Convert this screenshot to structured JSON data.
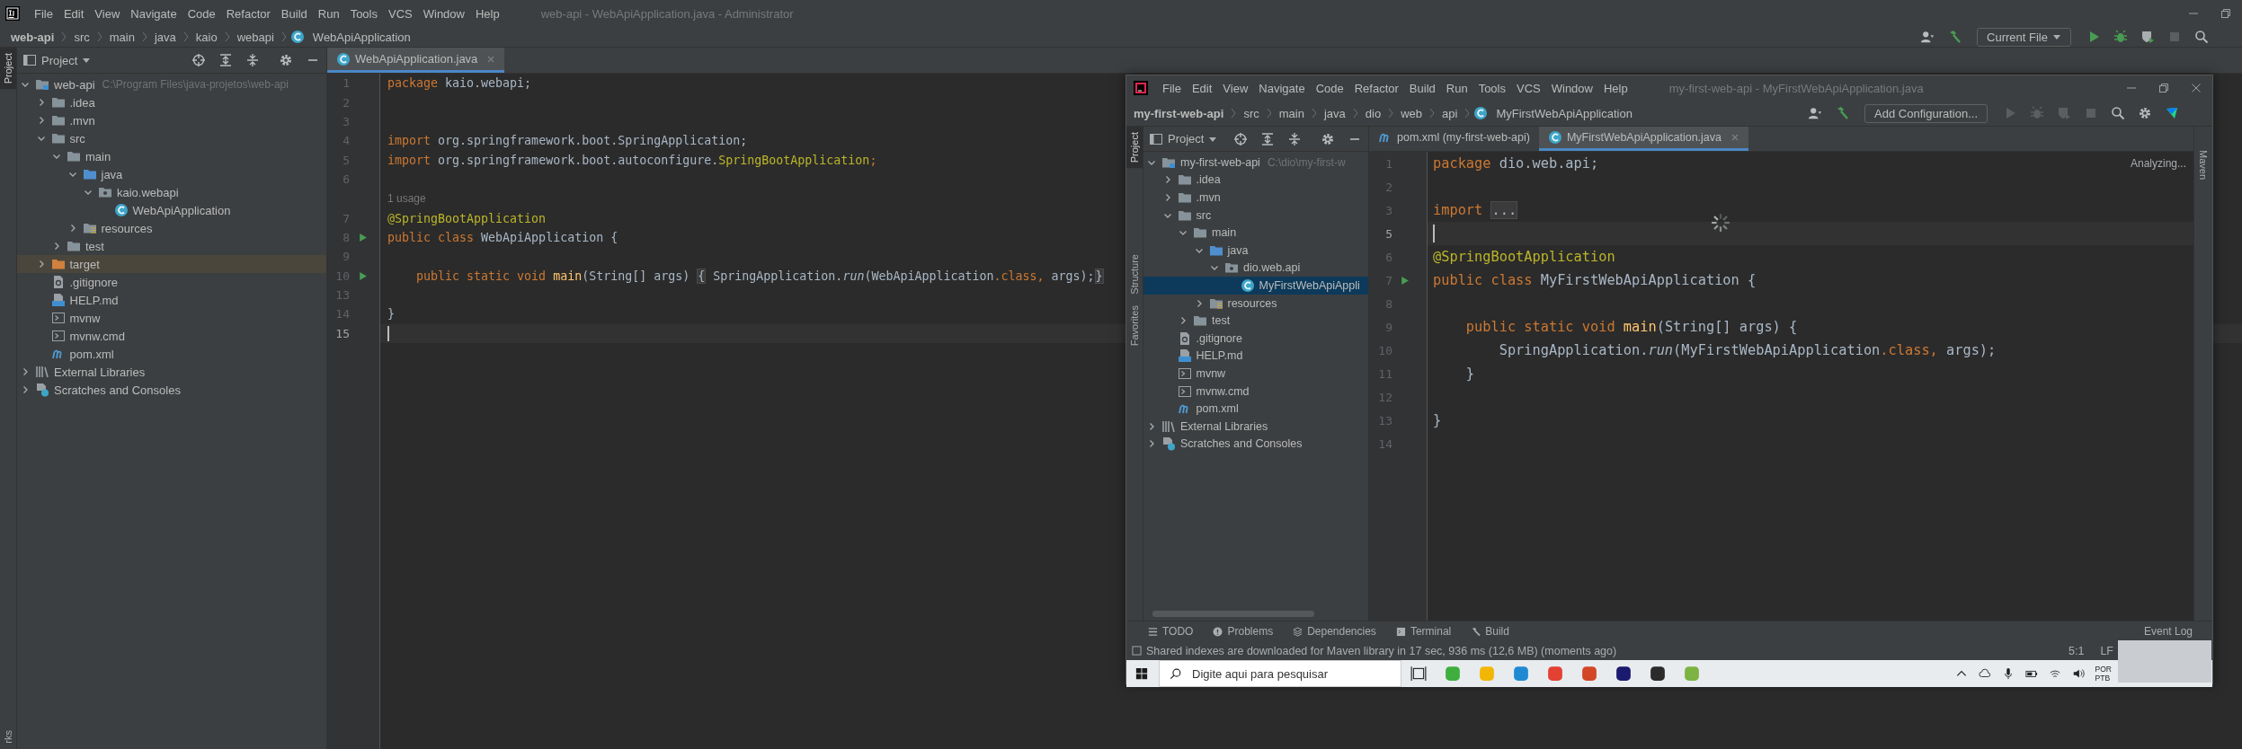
{
  "outer": {
    "menu": [
      "File",
      "Edit",
      "View",
      "Navigate",
      "Code",
      "Refactor",
      "Build",
      "Run",
      "Tools",
      "VCS",
      "Window",
      "Help"
    ],
    "title": "web-api - WebApiApplication.java - Administrator",
    "breadcrumb": [
      "web-api",
      "src",
      "main",
      "java",
      "kaio",
      "webapi",
      "WebApiApplication"
    ],
    "run_config": "Current File",
    "side_tabs": [
      {
        "label": "Project",
        "selected": true
      }
    ],
    "bottom_side_tab": "rks",
    "project": {
      "title": "Project",
      "tree": [
        {
          "label": "web-api",
          "path": "C:\\Program Files\\java-projetos\\web-api",
          "kind": "module",
          "expanded": true,
          "selected": false,
          "children": [
            {
              "label": ".idea",
              "kind": "folder",
              "expanded": false,
              "selected": false
            },
            {
              "label": ".mvn",
              "kind": "folder",
              "expanded": false,
              "selected": false
            },
            {
              "label": "src",
              "kind": "folder",
              "expanded": true,
              "selected": false,
              "children": [
                {
                  "label": "main",
                  "kind": "folder",
                  "expanded": true,
                  "selected": false,
                  "children": [
                    {
                      "label": "java",
                      "kind": "source",
                      "expanded": true,
                      "selected": false,
                      "children": [
                        {
                          "label": "kaio.webapi",
                          "kind": "package",
                          "expanded": true,
                          "selected": false,
                          "children": [
                            {
                              "label": "WebApiApplication",
                              "kind": "class",
                              "selected": false
                            }
                          ]
                        }
                      ]
                    },
                    {
                      "label": "resources",
                      "kind": "resources",
                      "expanded": false,
                      "selected": false
                    }
                  ]
                },
                {
                  "label": "test",
                  "kind": "folder",
                  "expanded": false,
                  "selected": false
                }
              ]
            },
            {
              "label": "target",
              "kind": "excluded",
              "expanded": false,
              "selected": false
            },
            {
              "label": ".gitignore",
              "kind": "ignore",
              "selected": false
            },
            {
              "label": "HELP.md",
              "kind": "markdown",
              "selected": false
            },
            {
              "label": "mvnw",
              "kind": "script",
              "selected": false
            },
            {
              "label": "mvnw.cmd",
              "kind": "script",
              "selected": false
            },
            {
              "label": "pom.xml",
              "kind": "maven",
              "selected": false
            }
          ]
        },
        {
          "label": "External Libraries",
          "kind": "libraries",
          "expanded": false,
          "selected": false
        },
        {
          "label": "Scratches and Consoles",
          "kind": "scratches",
          "expanded": false,
          "selected": false
        }
      ]
    },
    "tabs": [
      {
        "label": "WebApiApplication.java",
        "selected": true
      }
    ],
    "code": [
      {
        "kind": "code",
        "number": "1",
        "current": false,
        "run": false,
        "tokens": [
          {
            "kind": "kw",
            "text": "package"
          },
          {
            "kind": "plain",
            "text": " kaio.webapi;"
          }
        ]
      },
      {
        "kind": "code",
        "number": "2",
        "current": false,
        "run": false
      },
      {
        "kind": "code",
        "number": "3",
        "current": false,
        "run": false
      },
      {
        "kind": "code",
        "number": "4",
        "current": false,
        "run": false,
        "tokens": [
          {
            "kind": "kw",
            "text": "import"
          },
          {
            "kind": "plain",
            "text": " org.springframework.boot.SpringApplication;"
          }
        ]
      },
      {
        "kind": "code",
        "number": "5",
        "current": false,
        "run": false,
        "tokens": [
          {
            "kind": "kw",
            "text": "import"
          },
          {
            "kind": "plain",
            "text": " org.springframework.boot.autoconfigure."
          },
          {
            "kind": "ann",
            "text": "SpringBootApplication"
          },
          {
            "kind": "kw",
            "text": ";"
          }
        ]
      },
      {
        "kind": "code",
        "number": "6",
        "current": false,
        "run": false
      },
      {
        "kind": "hint",
        "text": "1 usage"
      },
      {
        "kind": "code",
        "number": "7",
        "current": false,
        "run": false,
        "tokens": [
          {
            "kind": "ann",
            "text": "@SpringBootApplication"
          }
        ]
      },
      {
        "kind": "code",
        "number": "8",
        "current": false,
        "run": true,
        "tokens": [
          {
            "kind": "kw",
            "text": "public class "
          },
          {
            "kind": "plain",
            "text": "WebApiApplication {"
          }
        ]
      },
      {
        "kind": "code",
        "number": "9",
        "current": false,
        "run": false
      },
      {
        "kind": "code",
        "number": "10",
        "current": false,
        "run": true,
        "tokens": [
          {
            "kind": "kw",
            "text": "    public static void "
          },
          {
            "kind": "fn",
            "text": "main"
          },
          {
            "kind": "plain",
            "text": "(String[] args) "
          },
          {
            "kind": "fold",
            "text": "{"
          },
          {
            "kind": "plain",
            "text": " SpringApplication."
          },
          {
            "kind": "static",
            "text": "run"
          },
          {
            "kind": "plain",
            "text": "(WebApiApplication"
          },
          {
            "kind": "kw",
            "text": ".class, "
          },
          {
            "kind": "plain",
            "text": "args);"
          },
          {
            "kind": "fold",
            "text": "}"
          }
        ]
      },
      {
        "kind": "code",
        "number": "13",
        "current": false,
        "run": false
      },
      {
        "kind": "code",
        "number": "14",
        "current": false,
        "run": false,
        "tokens": [
          {
            "kind": "plain",
            "text": "}"
          }
        ]
      },
      {
        "kind": "code",
        "number": "15",
        "current": true,
        "run": false
      }
    ]
  },
  "inner": {
    "menu": [
      "File",
      "Edit",
      "View",
      "Navigate",
      "Code",
      "Refactor",
      "Build",
      "Run",
      "Tools",
      "VCS",
      "Window",
      "Help"
    ],
    "title": "my-first-web-api - MyFirstWebApiApplication.java",
    "breadcrumb": [
      "my-first-web-api",
      "src",
      "main",
      "java",
      "dio",
      "web",
      "api",
      "MyFirstWebApiApplication"
    ],
    "run_config": "Add Configuration...",
    "side_tabs": [
      {
        "label": "Project",
        "selected": true
      },
      {
        "label": "Structure",
        "selected": false
      },
      {
        "label": "Favorites",
        "selected": false
      }
    ],
    "right_tabs": [
      "Maven"
    ],
    "project": {
      "title": "Project",
      "tree": [
        {
          "label": "my-first-web-api",
          "path": "C:\\dio\\my-first-w",
          "kind": "module",
          "expanded": true,
          "selected": false,
          "children": [
            {
              "label": ".idea",
              "kind": "folder",
              "expanded": false,
              "selected": false
            },
            {
              "label": ".mvn",
              "kind": "folder",
              "expanded": false,
              "selected": false
            },
            {
              "label": "src",
              "kind": "folder",
              "expanded": true,
              "selected": false,
              "children": [
                {
                  "label": "main",
                  "kind": "folder",
                  "expanded": true,
                  "selected": false,
                  "children": [
                    {
                      "label": "java",
                      "kind": "source",
                      "expanded": true,
                      "selected": false,
                      "children": [
                        {
                          "label": "dio.web.api",
                          "kind": "package",
                          "expanded": true,
                          "selected": false,
                          "children": [
                            {
                              "label": "MyFirstWebApiAppli",
                              "kind": "class",
                              "selected": true
                            }
                          ]
                        }
                      ]
                    },
                    {
                      "label": "resources",
                      "kind": "resources",
                      "expanded": false,
                      "selected": false
                    }
                  ]
                },
                {
                  "label": "test",
                  "kind": "folder",
                  "expanded": false,
                  "selected": false
                }
              ]
            },
            {
              "label": ".gitignore",
              "kind": "ignore",
              "selected": false
            },
            {
              "label": "HELP.md",
              "kind": "markdown",
              "selected": false
            },
            {
              "label": "mvnw",
              "kind": "script",
              "selected": false
            },
            {
              "label": "mvnw.cmd",
              "kind": "script",
              "selected": false
            },
            {
              "label": "pom.xml",
              "kind": "maven",
              "selected": false
            }
          ]
        },
        {
          "label": "External Libraries",
          "kind": "libraries",
          "expanded": false,
          "selected": false
        },
        {
          "label": "Scratches and Consoles",
          "kind": "scratches",
          "expanded": false,
          "selected": false
        }
      ]
    },
    "tabs": [
      {
        "label": "pom.xml (my-first-web-api)",
        "kind": "maven",
        "selected": false
      },
      {
        "label": "MyFirstWebApiApplication.java",
        "kind": "class",
        "selected": true
      }
    ],
    "analyzing": "Analyzing...",
    "code": [
      {
        "kind": "code",
        "number": "1",
        "current": false,
        "run": false,
        "tokens": [
          {
            "kind": "kw",
            "text": "package"
          },
          {
            "kind": "plain",
            "text": " dio.web.api;"
          }
        ]
      },
      {
        "kind": "code",
        "number": "2",
        "current": false,
        "run": false
      },
      {
        "kind": "code",
        "number": "3",
        "current": false,
        "run": false,
        "tokens": [
          {
            "kind": "kw",
            "text": "import "
          },
          {
            "kind": "fold",
            "text": "..."
          }
        ]
      },
      {
        "kind": "code",
        "number": "5",
        "current": true,
        "run": false
      },
      {
        "kind": "code",
        "number": "6",
        "current": false,
        "run": false,
        "tokens": [
          {
            "kind": "ann",
            "text": "@SpringBootApplication"
          }
        ]
      },
      {
        "kind": "code",
        "number": "7",
        "current": false,
        "run": true,
        "tokens": [
          {
            "kind": "kw",
            "text": "public class "
          },
          {
            "kind": "plain",
            "text": "MyFirstWebApiApplication {"
          }
        ]
      },
      {
        "kind": "code",
        "number": "8",
        "current": false,
        "run": false
      },
      {
        "kind": "code",
        "number": "9",
        "current": false,
        "run": false,
        "tokens": [
          {
            "kind": "kw",
            "text": "    public static void "
          },
          {
            "kind": "fn",
            "text": "main"
          },
          {
            "kind": "plain",
            "text": "(String[] args) {"
          }
        ]
      },
      {
        "kind": "code",
        "number": "10",
        "current": false,
        "run": false,
        "tokens": [
          {
            "kind": "plain",
            "text": "        SpringApplication."
          },
          {
            "kind": "static",
            "text": "run"
          },
          {
            "kind": "plain",
            "text": "(MyFirstWebApiApplication"
          },
          {
            "kind": "kw",
            "text": ".class, "
          },
          {
            "kind": "plain",
            "text": "args);"
          }
        ]
      },
      {
        "kind": "code",
        "number": "11",
        "current": false,
        "run": false,
        "tokens": [
          {
            "kind": "plain",
            "text": "    }"
          }
        ]
      },
      {
        "kind": "code",
        "number": "12",
        "current": false,
        "run": false
      },
      {
        "kind": "code",
        "number": "13",
        "current": false,
        "run": false,
        "tokens": [
          {
            "kind": "plain",
            "text": "}"
          }
        ]
      },
      {
        "kind": "code",
        "number": "14",
        "current": false,
        "run": false
      }
    ],
    "tool_tabs": [
      {
        "label": "TODO",
        "kind": "list"
      },
      {
        "label": "Problems",
        "kind": "problems"
      },
      {
        "label": "Dependencies",
        "kind": "layers"
      },
      {
        "label": "Terminal",
        "kind": "terminal"
      },
      {
        "label": "Build",
        "kind": "hammer"
      }
    ],
    "event_log": "Event Log",
    "status": "Shared indexes are downloaded for Maven library in 17 sec, 936 ms (12,6 MB) (moments ago)",
    "position": "5:1",
    "line_separator": "LF",
    "taskbar": {
      "search_placeholder": "Digite aqui para pesquisar",
      "apps": [
        {
          "color": "#3fae3f"
        },
        {
          "color": "#f2b705"
        },
        {
          "color": "#1f8ad2"
        },
        {
          "color": "#e34133"
        },
        {
          "color": "#d24726"
        },
        {
          "color": "#1a1a6e"
        },
        {
          "color": "#2b2b2b"
        },
        {
          "color": "#7cb342"
        }
      ],
      "language": [
        "POR",
        "PTB"
      ]
    }
  }
}
